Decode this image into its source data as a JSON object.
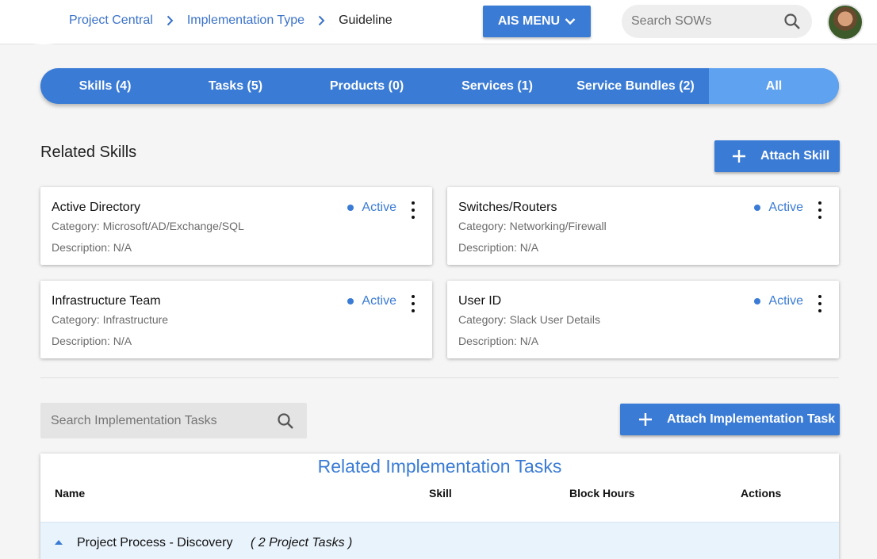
{
  "header": {
    "breadcrumbs": [
      {
        "label": "Project Central"
      },
      {
        "label": "Implementation Type"
      },
      {
        "label": "Guideline"
      }
    ],
    "menu_button": "AIS MENU",
    "search_placeholder": "Search SOWs"
  },
  "tabs": [
    {
      "label": "Skills (4)"
    },
    {
      "label": "Tasks (5)"
    },
    {
      "label": "Products (0)"
    },
    {
      "label": "Services (1)"
    },
    {
      "label": "Service Bundles (2)"
    },
    {
      "label": "All"
    }
  ],
  "skills": {
    "title": "Related Skills",
    "attach_button": "Attach Skill",
    "cards": [
      {
        "name": "Active Directory",
        "category": "Category: Microsoft/AD/Exchange/SQL",
        "description": "Description: N/A",
        "status": "Active"
      },
      {
        "name": "Switches/Routers",
        "category": "Category: Networking/Firewall",
        "description": "Description: N/A",
        "status": "Active"
      },
      {
        "name": "Infrastructure Team",
        "category": "Category: Infrastructure",
        "description": "Description: N/A",
        "status": "Active"
      },
      {
        "name": "User ID",
        "category": "Category: Slack User Details",
        "description": "Description: N/A",
        "status": "Active"
      }
    ]
  },
  "tasks": {
    "search_placeholder": "Search Implementation Tasks",
    "attach_button": "Attach Implementation Task",
    "table_title": "Related Implementation Tasks",
    "columns": [
      "Name",
      "Skill",
      "Block Hours",
      "Actions"
    ],
    "groups": [
      {
        "name": "Project Process - Discovery",
        "count": "( 2 Project Tasks )"
      }
    ]
  },
  "colors": {
    "primary": "#3a7bd5",
    "active_tab": "#5fa2f0",
    "link": "#3a72c9"
  },
  "icons": [
    "chevron-right-icon",
    "chevron-down-icon",
    "search-icon",
    "plus-icon",
    "more-vert-icon",
    "caret-up-icon"
  ]
}
